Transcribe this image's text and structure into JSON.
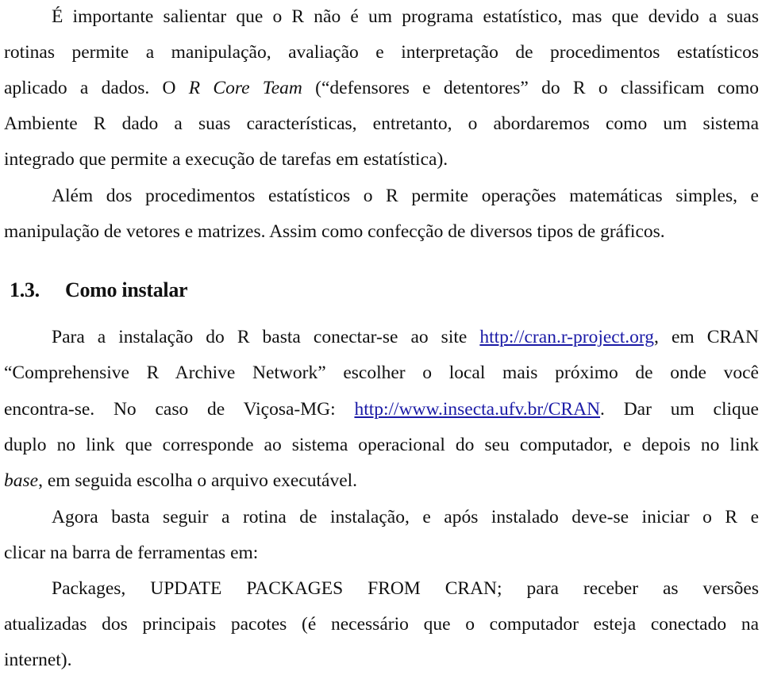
{
  "document": {
    "paragraph1": {
      "line1": "É importante salientar que o R não é um programa estatístico, mas que devido a suas",
      "line2": "rotinas permite a manipulação, avaliação e interpretação de procedimentos estatísticos",
      "line3_pre": "aplicado a dados. O ",
      "line3_italic": "R Core Team",
      "line3_post": " (“defensores e detentores” do R o classificam como",
      "line4": "Ambiente R dado a suas características, entretanto, o abordaremos como um sistema",
      "line5": "integrado que permite a execução de tarefas em estatística)."
    },
    "paragraph2": {
      "line1": "Além dos procedimentos estatísticos o R permite operações matemáticas simples, e",
      "line2": "manipulação de vetores e matrizes. Assim como confecção de diversos tipos de gráficos."
    },
    "section": {
      "number": "1.3.",
      "title": "Como instalar"
    },
    "paragraph3": {
      "line1_pre": "Para a instalação do R basta conectar-se ao site ",
      "link1": "http://cran.r-project.org",
      "line1_post": ", em CRAN",
      "line2": "“Comprehensive R Archive Network” escolher o local mais próximo de onde você",
      "line3_pre": "encontra-se. No caso de Viçosa-MG: ",
      "link2": "http://www.insecta.ufv.br/CRAN",
      "line3_post": ". Dar um clique",
      "line4": "duplo no link que corresponde ao sistema operacional do seu computador, e depois no link",
      "line5_italic": "base",
      "line5_post": ", em seguida escolha o arquivo executável."
    },
    "paragraph4": {
      "line1": "Agora basta seguir a rotina de instalação, e após instalado deve-se iniciar o R e",
      "line2": "clicar na barra de ferramentas em:"
    },
    "paragraph5": {
      "line1": "Packages, UPDATE PACKAGES FROM CRAN; para receber as versões",
      "line2": "atualizadas dos principais pacotes (é necessário que o computador esteja conectado na",
      "line3": "internet)."
    },
    "colors": {
      "text": "#111111",
      "link": "#1a1aa6",
      "background": "#ffffff"
    }
  }
}
